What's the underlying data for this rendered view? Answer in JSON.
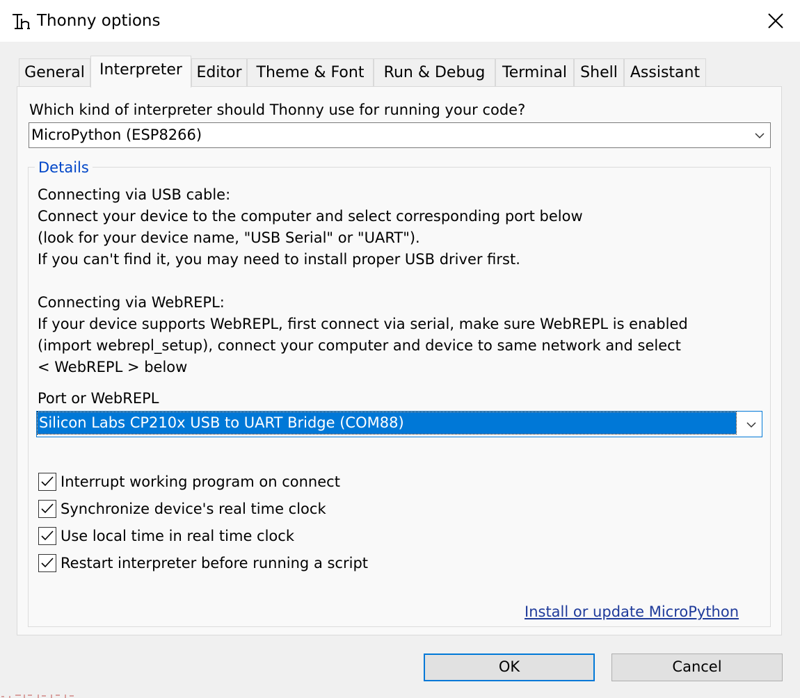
{
  "window": {
    "title": "Thonny options"
  },
  "tabs": [
    {
      "label": "General"
    },
    {
      "label": "Interpreter"
    },
    {
      "label": "Editor"
    },
    {
      "label": "Theme & Font"
    },
    {
      "label": "Run & Debug"
    },
    {
      "label": "Terminal"
    },
    {
      "label": "Shell"
    },
    {
      "label": "Assistant"
    }
  ],
  "active_tab": "Interpreter",
  "interpreter": {
    "question": "Which kind of interpreter should Thonny use for running your code?",
    "selected": "MicroPython (ESP8266)"
  },
  "details": {
    "title": "Details",
    "lines": [
      "Connecting via USB cable:",
      "Connect your device to the computer and select corresponding port below",
      "(look for your device name, \"USB Serial\" or \"UART\").",
      "If you can't find it, you may need to install proper USB driver first.",
      "Connecting via WebREPL:",
      "If your device supports WebREPL, first connect via serial, make sure WebREPL is enabled",
      "(import webrepl_setup), connect your computer and device to same network and select",
      "< WebREPL > below"
    ],
    "port_label": "Port or WebREPL",
    "port_selected": "Silicon Labs CP210x USB to UART Bridge (COM88)",
    "checkboxes": [
      {
        "label": "Interrupt working program on connect",
        "checked": true
      },
      {
        "label": "Synchronize device's real time clock",
        "checked": true
      },
      {
        "label": "Use local time in real time clock",
        "checked": true
      },
      {
        "label": "Restart interpreter before running a script",
        "checked": true
      }
    ],
    "install_link": "Install or update MicroPython"
  },
  "buttons": {
    "ok": "OK",
    "cancel": "Cancel"
  },
  "colors": {
    "accent": "#0078d7",
    "group_title": "#0046c8",
    "link": "#1e3a9a"
  }
}
